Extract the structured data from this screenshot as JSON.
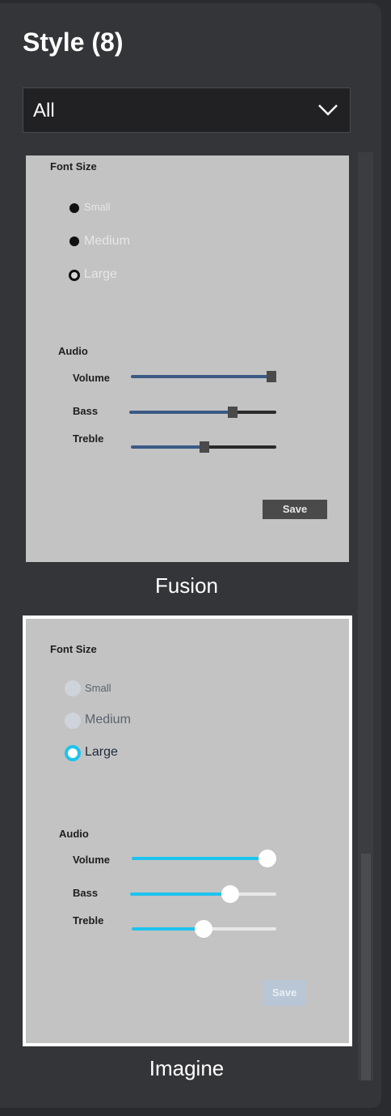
{
  "panel": {
    "title": "Style (8)",
    "filter": {
      "selected": "All"
    }
  },
  "styles": [
    {
      "caption": "Fusion",
      "preview": {
        "font_size_label": "Font Size",
        "options": [
          "Small",
          "Medium",
          "Large"
        ],
        "audio_label": "Audio",
        "sliders": [
          {
            "label": "Volume",
            "value": 1.0
          },
          {
            "label": "Bass",
            "value": 0.7
          },
          {
            "label": "Treble",
            "value": 0.5
          }
        ],
        "save_label": "Save"
      }
    },
    {
      "caption": "Imagine",
      "preview": {
        "font_size_label": "Font Size",
        "options": [
          "Small",
          "Medium",
          "Large"
        ],
        "audio_label": "Audio",
        "sliders": [
          {
            "label": "Volume",
            "value": 1.0
          },
          {
            "label": "Bass",
            "value": 0.68
          },
          {
            "label": "Treble",
            "value": 0.5
          }
        ],
        "save_label": "Save"
      }
    }
  ],
  "colors": {
    "panel_bg": "#343538",
    "fusion_accent": "#3b5a85",
    "imagine_accent": "#1ec3ee",
    "selection_border": "#ffffff"
  },
  "scroll": {
    "position": 0.75
  }
}
